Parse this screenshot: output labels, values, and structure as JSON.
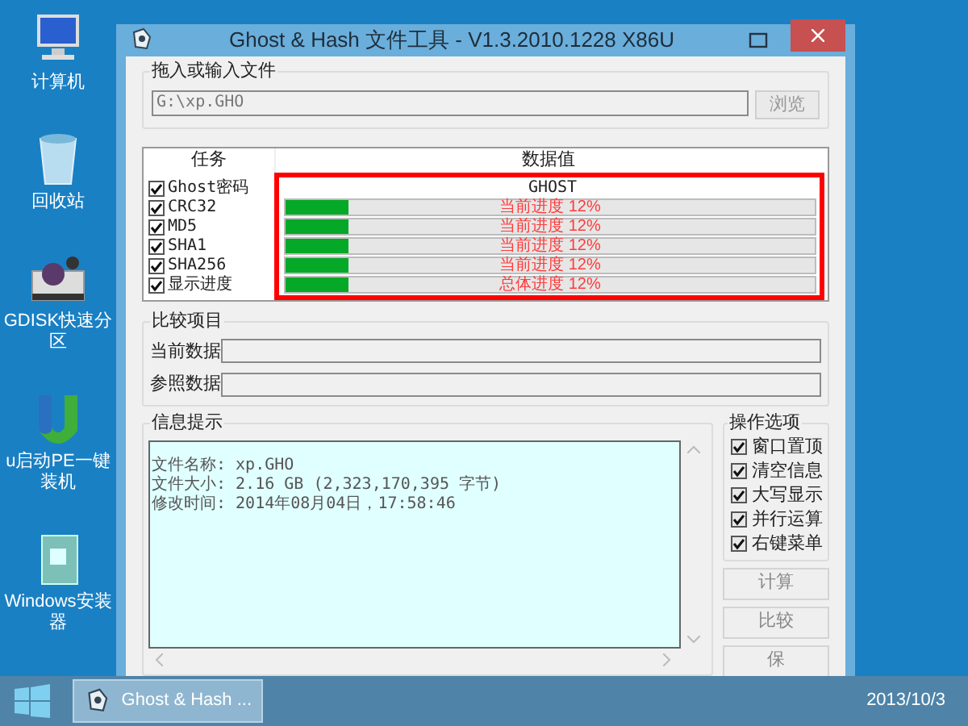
{
  "desktop_icons": [
    {
      "label": "计算机",
      "kind": "computer"
    },
    {
      "label": "回收站",
      "kind": "bin"
    },
    {
      "label": "GDISK快速分区",
      "kind": "disk"
    },
    {
      "label": "u启动PE一键装机",
      "kind": "u"
    },
    {
      "label": "Windows安装器",
      "kind": "installer"
    }
  ],
  "window": {
    "title": "Ghost & Hash 文件工具 - V1.3.2010.1228 X86U",
    "file_group": {
      "label": "拖入或输入文件",
      "path": "G:\\xp.GHO",
      "browse_button": "浏览"
    },
    "tasks": {
      "columns": [
        "任务",
        "数据值"
      ],
      "rows": [
        {
          "label": "Ghost密码",
          "checked": true,
          "kind": "text",
          "value": "GHOST"
        },
        {
          "label": "CRC32",
          "checked": true,
          "kind": "progress",
          "level": 0.12,
          "reading": "当前进度 12%"
        },
        {
          "label": "MD5",
          "checked": true,
          "kind": "progress",
          "level": 0.12,
          "reading": "当前进度 12%"
        },
        {
          "label": "SHA1",
          "checked": true,
          "kind": "progress",
          "level": 0.12,
          "reading": "当前进度 12%"
        },
        {
          "label": "SHA256",
          "checked": true,
          "kind": "progress",
          "level": 0.12,
          "reading": "当前进度 12%"
        },
        {
          "label": "显示进度",
          "checked": true,
          "kind": "progress",
          "level": 0.12,
          "reading": "总体进度 12%"
        }
      ]
    },
    "compare": {
      "label": "比较项目",
      "fields": [
        {
          "label": "当前数据"
        },
        {
          "label": "参照数据"
        }
      ]
    },
    "info": {
      "label": "信息提示",
      "lines": [
        "文件名称: xp.GHO",
        "文件大小: 2.16 GB (2,323,170,395 字节)",
        "修改时间: 2014年08月04日，17:58:46"
      ]
    },
    "options": {
      "label": "操作选项",
      "items": [
        {
          "label": "窗口置顶",
          "checked": true
        },
        {
          "label": "清空信息",
          "checked": true
        },
        {
          "label": "大写显示",
          "checked": true
        },
        {
          "label": "并行运算",
          "checked": true
        },
        {
          "label": "右键菜单",
          "checked": true
        }
      ]
    },
    "buttons": [
      "计算",
      "比较",
      "保"
    ]
  },
  "taskbar": {
    "task": "Ghost & Hash ...",
    "date": "2013/10/3"
  }
}
